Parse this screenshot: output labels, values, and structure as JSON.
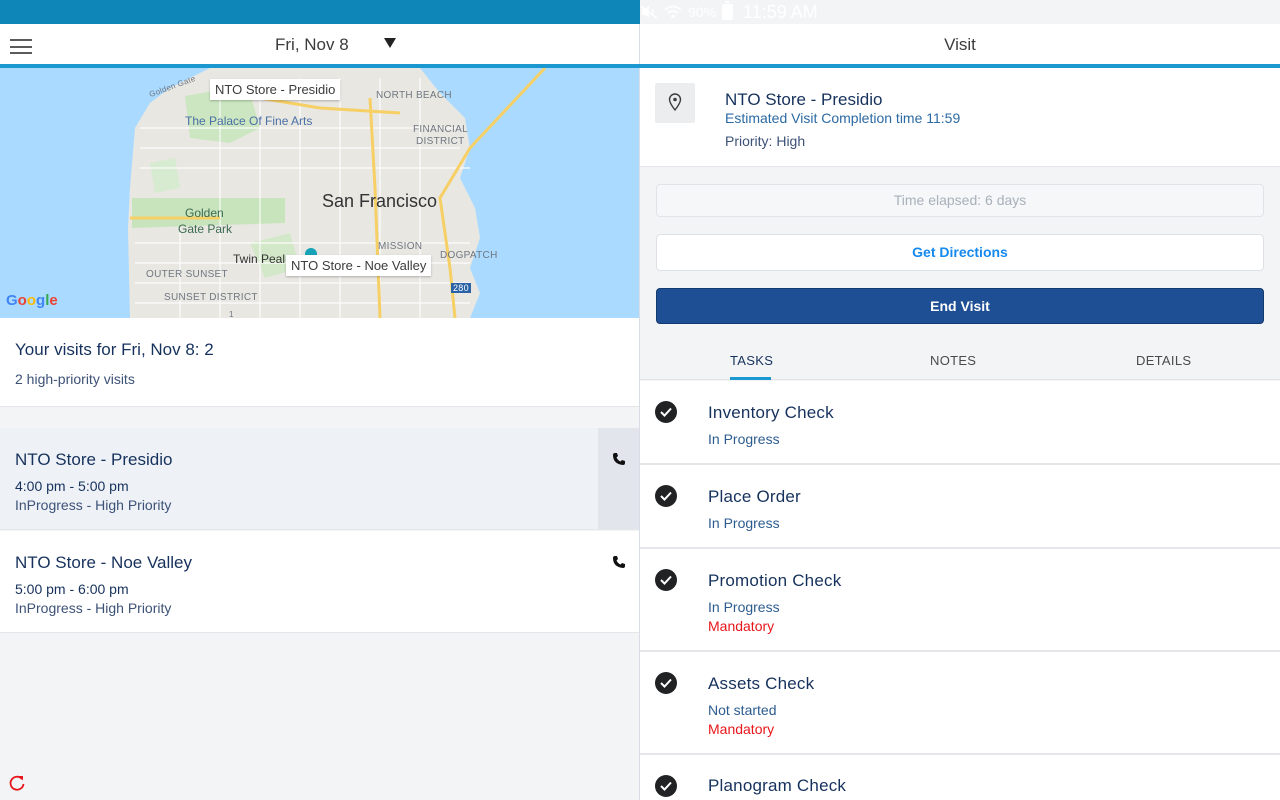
{
  "status_bar": {
    "battery": "90%",
    "time": "11:59 AM",
    "icons": [
      "mute-icon",
      "wifi-icon",
      "battery-icon"
    ]
  },
  "left_header": {
    "menu_icon": "hamburger-menu-icon",
    "date": "Fri, Nov 8",
    "dropdown_icon": "caret-down-icon"
  },
  "map": {
    "callout_1": "NTO Store - Presidio",
    "callout_2": "NTO Store - Noe Valley",
    "city": "San Francisco",
    "labels": {
      "golden_gate": "Golden Gate",
      "north_beach": "NORTH BEACH",
      "financial": "FINANCIAL",
      "district": "DISTRICT",
      "palace": "The Palace Of Fine Arts",
      "golden_gate_park_1": "Golden",
      "golden_gate_park_2": "Gate Park",
      "mission": "MISSION",
      "twin_peaks": "Twin Peal",
      "dogpatch": "DOGPATCH",
      "outer_sunset": "OUTER SUNSET",
      "sunset_district": "SUNSET DISTRICT",
      "hwy_280": "280",
      "hwy_1": "1"
    },
    "google_letters": [
      "G",
      "o",
      "o",
      "g",
      "l",
      "e"
    ]
  },
  "summary": {
    "heading": "Your visits for Fri, Nov 8: 2",
    "sub": "2 high-priority visits"
  },
  "visits": [
    {
      "name": "NTO Store - Presidio",
      "time": "4:00 pm - 5:00 pm",
      "status": "InProgress - High Priority"
    },
    {
      "name": "NTO Store - Noe Valley",
      "time": "5:00 pm - 6:00 pm",
      "status": "InProgress - High Priority"
    }
  ],
  "right_header": {
    "title": "Visit"
  },
  "account": {
    "name": "NTO Store - Presidio",
    "estimate": "Estimated Visit Completion time 11:59",
    "priority": "Priority: High"
  },
  "elapsed": "Time elapsed: 6 days",
  "buttons": {
    "directions": "Get Directions",
    "end_visit": "End Visit"
  },
  "tabs": [
    "TASKS",
    "NOTES",
    "DETAILS"
  ],
  "tasks": [
    {
      "name": "Inventory Check",
      "status": "In Progress",
      "mandatory": ""
    },
    {
      "name": "Place Order",
      "status": "In Progress",
      "mandatory": ""
    },
    {
      "name": "Promotion Check",
      "status": "In Progress",
      "mandatory": "Mandatory"
    },
    {
      "name": "Assets Check",
      "status": "Not started",
      "mandatory": "Mandatory"
    },
    {
      "name": "Planogram Check",
      "status": "",
      "mandatory": ""
    }
  ],
  "colors": {
    "status_bar": "#0f86b8",
    "accent": "#1b98cf",
    "end_visit": "#1e4f94",
    "mandatory": "#e8161b"
  }
}
